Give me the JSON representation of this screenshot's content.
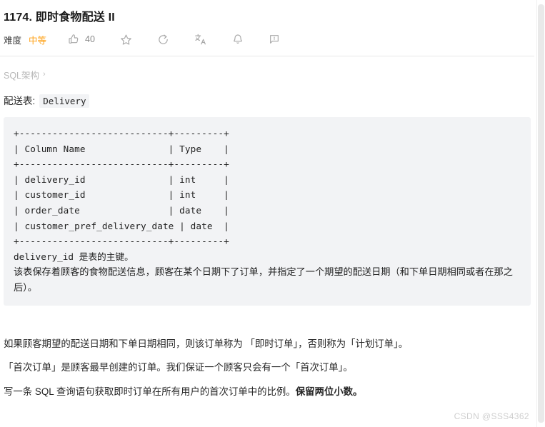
{
  "problem": {
    "title": "1174. 即时食物配送 II",
    "difficulty_label": "难度",
    "difficulty_value": "中等",
    "difficulty_color": "#ffa116"
  },
  "toolbar": {
    "like_icon": "thumbs-up-icon",
    "like_count": "40",
    "favorite_icon": "star-icon",
    "share_icon": "share-icon",
    "translate_icon": "translate-icon",
    "notify_icon": "bell-icon",
    "report_icon": "report-icon"
  },
  "schema": {
    "label": "SQL架构",
    "chevron": "›"
  },
  "table": {
    "caption": "配送表:",
    "name": "Delivery"
  },
  "code": {
    "ascii_table": "+---------------------------+---------+\n| Column Name               | Type    |\n+---------------------------+---------+\n| delivery_id               | int     |\n| customer_id               | int     |\n| order_date                | date    |\n| customer_pref_delivery_date | date  |\n+---------------------------+---------+",
    "rows": [
      {
        "column": "delivery_id",
        "type": "int"
      },
      {
        "column": "customer_id",
        "type": "int"
      },
      {
        "column": "order_date",
        "type": "date"
      },
      {
        "column": "customer_pref_delivery_date",
        "type": "date"
      }
    ],
    "headers": {
      "column": "Column Name",
      "type": "Type"
    },
    "primary_key_note": "delivery_id 是表的主键。",
    "description": "该表保存着顾客的食物配送信息，顾客在某个日期下了订单，并指定了一个期望的配送日期（和下单日期相同或者在那之后）。"
  },
  "body": {
    "paragraph_1": "如果顾客期望的配送日期和下单日期相同，则该订单称为 「即时订单」，否则称为「计划订单」。",
    "paragraph_2": "「首次订单」是顾客最早创建的订单。我们保证一个顾客只会有一个「首次订单」。",
    "paragraph_3_normal": "写一条 SQL 查询语句获取即时订单在所有用户的首次订单中的比例。",
    "paragraph_3_bold": "保留两位小数。"
  },
  "watermark": {
    "text": "CSDN @SSS4362"
  }
}
